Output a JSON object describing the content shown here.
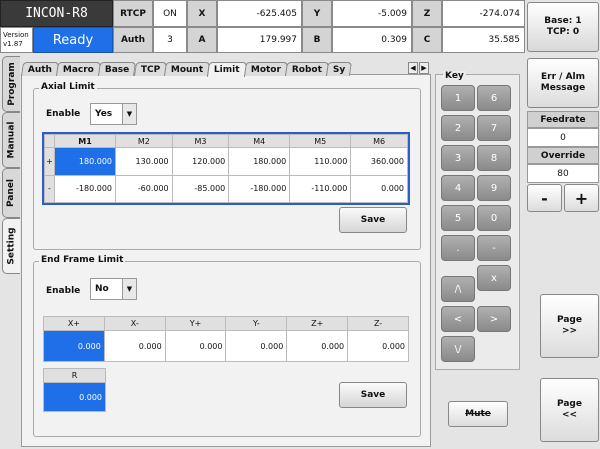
{
  "header": {
    "title": "INCON-R8",
    "version_label": "Version",
    "version": "v1.87",
    "status": "Ready",
    "rtcp_label": "RTCP",
    "rtcp_value": "ON",
    "auth_label": "Auth",
    "auth_value": "3",
    "coords": [
      {
        "label": "X",
        "value": "-625.405"
      },
      {
        "label": "Y",
        "value": "-5.009"
      },
      {
        "label": "Z",
        "value": "-274.074"
      },
      {
        "label": "A",
        "value": "179.997"
      },
      {
        "label": "B",
        "value": "0.309"
      },
      {
        "label": "C",
        "value": "35.585"
      }
    ],
    "base_tcp": "Base: 1\nTCP: 0"
  },
  "side_tabs": [
    "Program",
    "Manual",
    "Panel",
    "Setting"
  ],
  "tabs": [
    "Auth",
    "Macro",
    "Base",
    "TCP",
    "Mount",
    "Limit",
    "Motor",
    "Robot",
    "Sy"
  ],
  "axial": {
    "title": "Axial Limit",
    "enable_label": "Enable",
    "enable_value": "Yes",
    "headers": [
      "M1",
      "M2",
      "M3",
      "M4",
      "M5",
      "M6"
    ],
    "plus_label": "+",
    "minus_label": "-",
    "plus": [
      "180.000",
      "130.000",
      "120.000",
      "180.000",
      "110.000",
      "360.000"
    ],
    "minus": [
      "-180.000",
      "-60.000",
      "-85.000",
      "-180.000",
      "-110.000",
      "0.000"
    ],
    "save": "Save"
  },
  "endframe": {
    "title": "End Frame Limit",
    "enable_label": "Enable",
    "enable_value": "No",
    "headers": [
      "X+",
      "X-",
      "Y+",
      "Y-",
      "Z+",
      "Z-"
    ],
    "values": [
      "0.000",
      "0.000",
      "0.000",
      "0.000",
      "0.000",
      "0.000"
    ],
    "r_header": "R",
    "r_value": "0.000",
    "save": "Save"
  },
  "keypad": {
    "title": "Key",
    "keys": [
      "1",
      "6",
      "2",
      "7",
      "3",
      "8",
      "4",
      "9",
      "5",
      "0",
      ".",
      "-",
      "x",
      "/\\",
      "<",
      ">",
      "\\/"
    ],
    "mute": "Mute"
  },
  "right": {
    "err_alm": "Err / Alm\nMessage",
    "feedrate_label": "Feedrate",
    "feedrate_value": "0",
    "override_label": "Override",
    "override_value": "80",
    "minus": "-",
    "plus": "+",
    "page_next": "Page\n>>",
    "page_prev": "Page\n<<"
  },
  "colors": {
    "accent": "#1e6fe8",
    "title_bg": "#3a3a3a"
  }
}
